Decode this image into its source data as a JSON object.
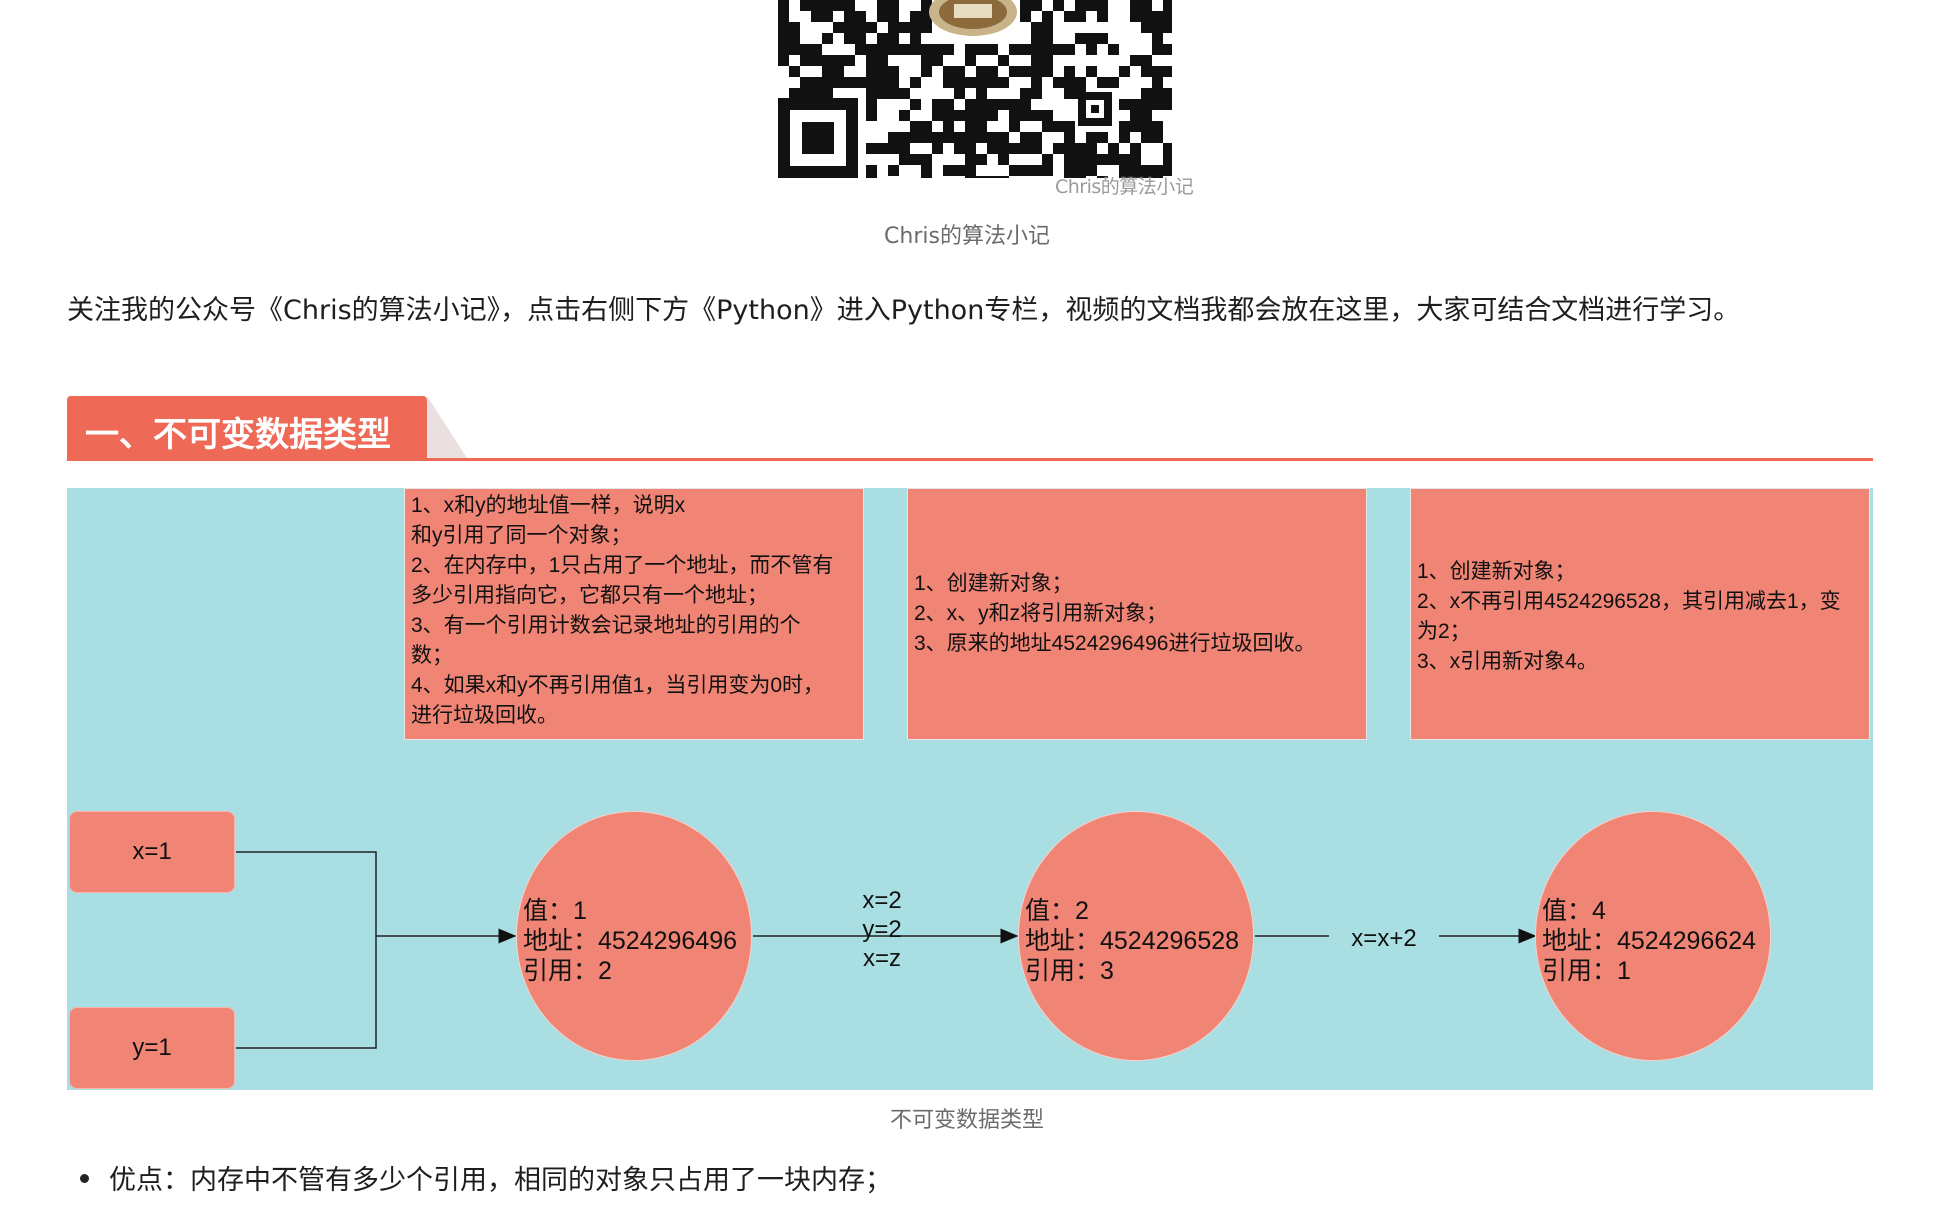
{
  "qr": {
    "watermark": "Chris的算法小记",
    "caption": "Chris的算法小记"
  },
  "intro": "关注我的公众号《Chris的算法小记》，点击右侧下方《Python》进入Python专栏，视频的文档我都会放在这里，大家可结合文档进行学习。",
  "section": {
    "title": "一、不可变数据类型"
  },
  "diagram": {
    "notes": [
      [
        "1、x和y的地址值一样，说明x",
        "和y引用了同一个对象；",
        "2、在内存中，1只占用了一个地址，而不管有",
        "多少引用指向它，它都只有一个地址；",
        "3、有一个引用计数会记录地址的引用的个",
        "数；",
        "4、如果x和y不再引用值1，当引用变为0时，",
        "进行垃圾回收。"
      ],
      [
        "1、创建新对象；",
        "2、x、y和z将引用新对象；",
        "3、原来的地址4524296496进行垃圾回收。"
      ],
      [
        "1、创建新对象；",
        "2、x不再引用4524296528，其引用减去1，变",
        "为2；",
        "3、x引用新对象4。"
      ]
    ],
    "variables": [
      "x=1",
      "y=1"
    ],
    "objects": [
      {
        "value": "值：1",
        "address": "地址：4524296496",
        "refs": "引用：2"
      },
      {
        "value": "值：2",
        "address": "地址：4524296528",
        "refs": "引用：3"
      },
      {
        "value": "值：4",
        "address": "地址：4524296624",
        "refs": "引用：1"
      }
    ],
    "edge_labels": [
      [
        "x=2",
        "y=2",
        "x=z"
      ],
      [
        "x=x+2"
      ]
    ],
    "caption": "不可变数据类型"
  },
  "bullet": "优点：内存中不管有多少个引用，相同的对象只占用了一块内存；"
}
